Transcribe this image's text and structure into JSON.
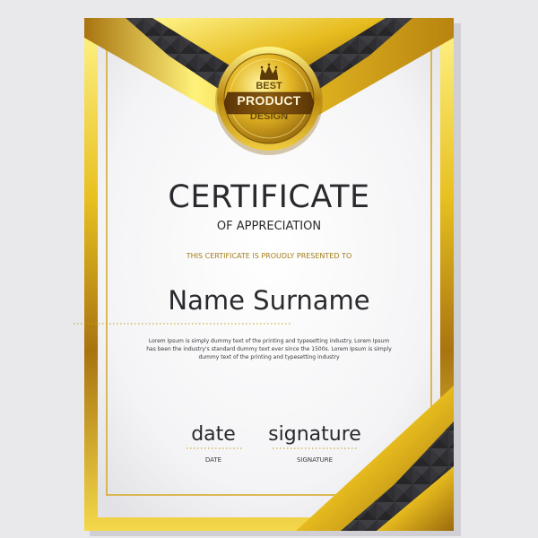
{
  "certificate": {
    "title": "CERTIFICATE",
    "subtitle": "OF APPRECIATION",
    "presented": "THIS CERTIFICATE IS PROUDLY PRESENTED TO",
    "name": "Name Surname",
    "body": "Lorem Ipsum is simply dummy text of the printing and typesetting industry. Lorem Ipsum has been the industry's standard dummy text ever since the 1500s. Lorem Ipsum is simply dummy text of the printing and typesetting industry",
    "date_script": "date",
    "date_label": "DATE",
    "signature_script": "signature",
    "signature_label": "SIGNATURE"
  },
  "medal": {
    "line1": "BEST",
    "line2": "PRODUCT",
    "line3": "DESIGN",
    "icon": "crown-icon"
  },
  "colors": {
    "gold_light": "#fff27a",
    "gold": "#e8c020",
    "gold_dark": "#a87410",
    "dark_band": "#2f2f33",
    "page_bg": "#e9e9ec",
    "paper": "#fbfbfb",
    "presented_text": "#a27c14"
  }
}
